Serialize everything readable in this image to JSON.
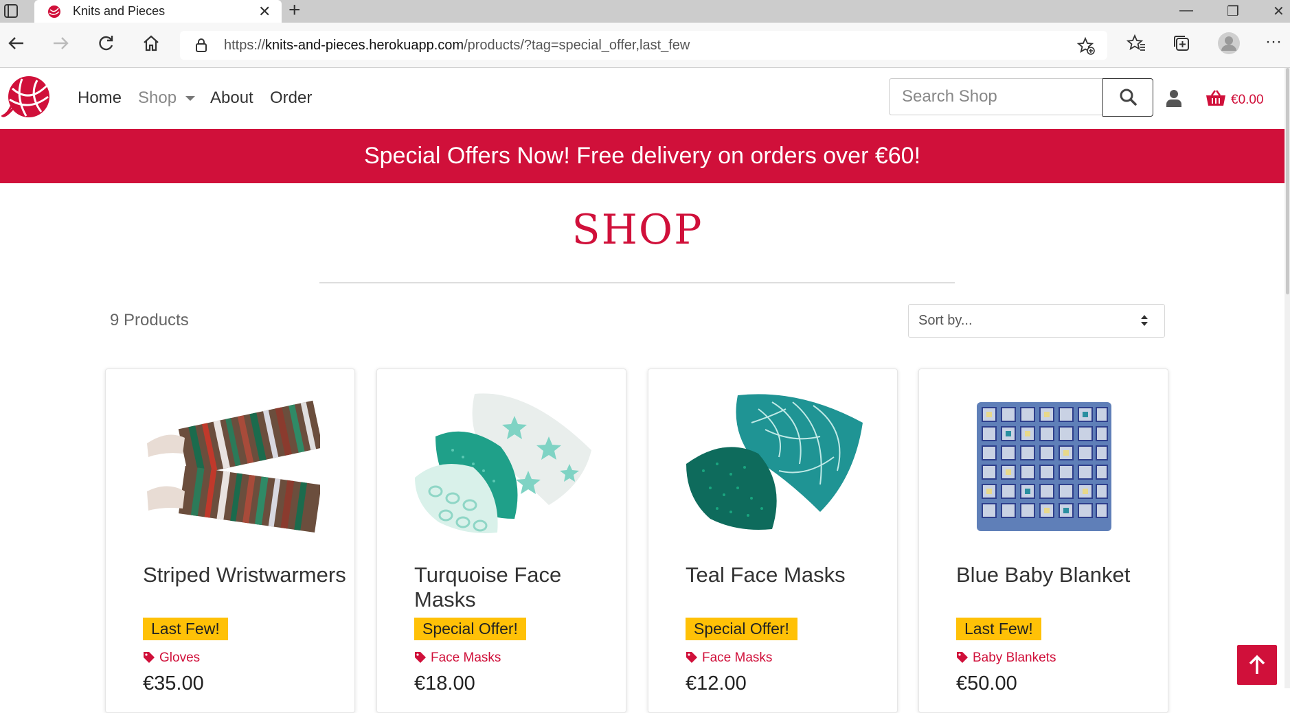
{
  "browser": {
    "tab_title": "Knits and Pieces",
    "url_prefix": "https://",
    "url_host": "knits-and-pieces.herokuapp.com",
    "url_path": "/products/?tag=special_offer,last_few"
  },
  "nav": {
    "links": [
      "Home",
      "Shop",
      "About",
      "Order"
    ],
    "search_placeholder": "Search Shop",
    "basket_total": "€0.00"
  },
  "promo_banner": "Special Offers Now! Free delivery on orders over €60!",
  "page_title": "SHOP",
  "product_count": "9 Products",
  "sort": {
    "selected": "Sort by..."
  },
  "products": [
    {
      "name": "Striped Wristwarmers",
      "badge": "Last Few!",
      "category": "Gloves",
      "price": "€35.00"
    },
    {
      "name": "Turquoise Face Masks",
      "badge": "Special Offer!",
      "category": "Face Masks",
      "price": "€18.00"
    },
    {
      "name": "Teal Face Masks",
      "badge": "Special Offer!",
      "category": "Face Masks",
      "price": "€12.00"
    },
    {
      "name": "Blue Baby Blanket",
      "badge": "Last Few!",
      "category": "Baby Blankets",
      "price": "€50.00"
    }
  ],
  "colors": {
    "brand": "#d0103a",
    "badge": "#ffc107"
  }
}
